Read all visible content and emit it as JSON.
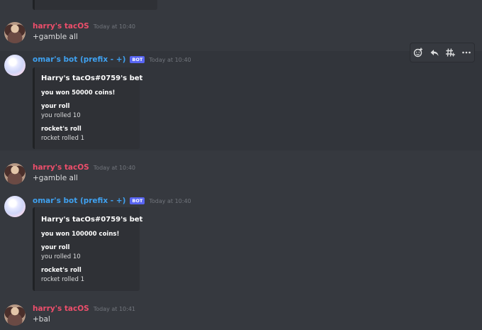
{
  "messages": [
    {
      "author": "harry's tacOS",
      "time": "Today at 10:40",
      "text": "+gamble all"
    },
    {
      "author": "omar's bot (prefix - +)",
      "badge": "BOT",
      "time": "Today at 10:40",
      "embed": {
        "title": "Harry's tacOs#0759's bet",
        "description": "you won 50000 coins!",
        "fields": [
          {
            "name": "your roll",
            "value": "you rolled 10"
          },
          {
            "name": "rocket's roll",
            "value": "rocket rolled 1"
          }
        ]
      }
    },
    {
      "author": "harry's tacOS",
      "time": "Today at 10:40",
      "text": "+gamble all"
    },
    {
      "author": "omar's bot (prefix - +)",
      "badge": "BOT",
      "time": "Today at 10:40",
      "embed": {
        "title": "Harry's tacOs#0759's bet",
        "description": "you won 100000 coins!",
        "fields": [
          {
            "name": "your roll",
            "value": "you rolled 10"
          },
          {
            "name": "rocket's roll",
            "value": "rocket rolled 1"
          }
        ]
      }
    },
    {
      "author": "harry's tacOS",
      "time": "Today at 10:41",
      "text": "+bal"
    }
  ],
  "toolbar": {
    "icons": [
      "add-reaction-icon",
      "reply-icon",
      "create-thread-icon",
      "more-options-icon"
    ]
  },
  "colors": {
    "background": "#36393f",
    "user_name": "#ed4e6b",
    "bot_name": "#3fa1f0",
    "bot_badge": "#5865f2",
    "embed_bg": "#2f3136"
  }
}
